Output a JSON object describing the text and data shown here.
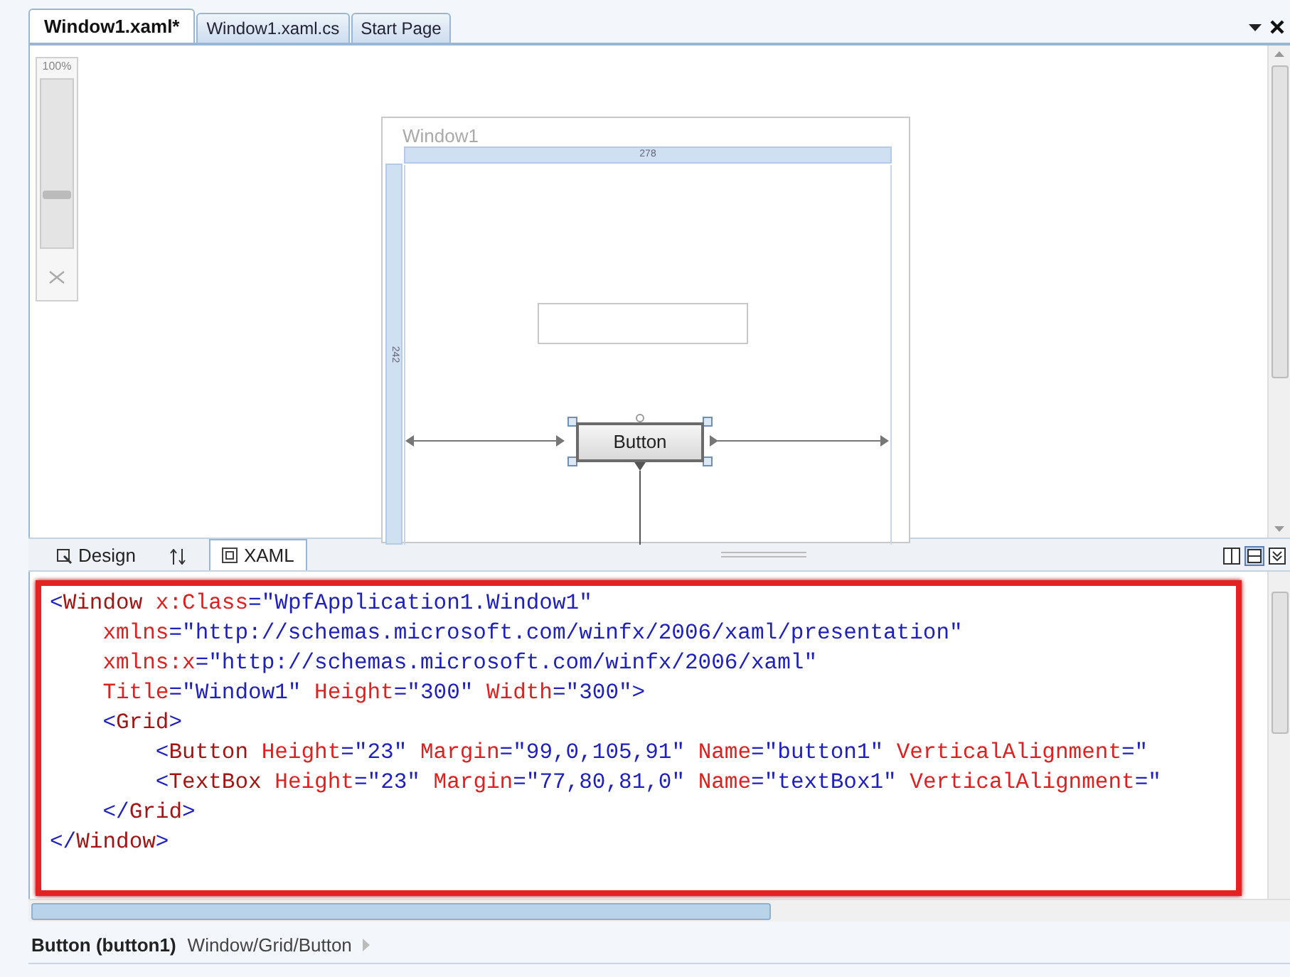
{
  "document_tabs": [
    {
      "label": "Window1.xaml*",
      "selected": true
    },
    {
      "label": "Window1.xaml.cs",
      "selected": false
    },
    {
      "label": "Start Page",
      "selected": false
    }
  ],
  "zoom": {
    "label": "100%",
    "level": 0.3
  },
  "designer": {
    "window_title": "Window1",
    "width_ruler": "278",
    "height_ruler": "242",
    "button_label": "Button"
  },
  "view_tabs": [
    {
      "kind": "design",
      "label": "Design",
      "selected": false
    },
    {
      "kind": "swap",
      "selected": false
    },
    {
      "kind": "xaml",
      "label": "XAML",
      "selected": true
    }
  ],
  "code_lines": [
    {
      "tokens": [
        {
          "kind": "punct",
          "text": "<"
        },
        {
          "kind": "element",
          "text": "Window"
        },
        {
          "kind": "attribute",
          "text": " x:Class"
        },
        {
          "kind": "punct",
          "text": "=\"WpfApplication1.Window1\""
        }
      ]
    },
    {
      "tokens": [
        {
          "kind": "attribute",
          "text": "    xmlns"
        },
        {
          "kind": "punct",
          "text": "=\"http://schemas.microsoft.com/winfx/2006/xaml/presentation\""
        }
      ]
    },
    {
      "tokens": [
        {
          "kind": "attribute",
          "text": "    xmlns:x"
        },
        {
          "kind": "punct",
          "text": "=\"http://schemas.microsoft.com/winfx/2006/xaml\""
        }
      ]
    },
    {
      "tokens": [
        {
          "kind": "attribute",
          "text": "    Title"
        },
        {
          "kind": "punct",
          "text": "=\"Window1\""
        },
        {
          "kind": "attribute",
          "text": " Height"
        },
        {
          "kind": "punct",
          "text": "=\"300\""
        },
        {
          "kind": "attribute",
          "text": " Width"
        },
        {
          "kind": "punct",
          "text": "=\"300\">"
        }
      ]
    },
    {
      "tokens": [
        {
          "kind": "punct",
          "text": "    <"
        },
        {
          "kind": "element",
          "text": "Grid"
        },
        {
          "kind": "punct",
          "text": ">"
        }
      ]
    },
    {
      "tokens": [
        {
          "kind": "punct",
          "text": "        <"
        },
        {
          "kind": "element",
          "text": "Button"
        },
        {
          "kind": "attribute",
          "text": " Height"
        },
        {
          "kind": "punct",
          "text": "=\"23\""
        },
        {
          "kind": "attribute",
          "text": " Margin"
        },
        {
          "kind": "punct",
          "text": "=\"99,0,105,91\""
        },
        {
          "kind": "attribute",
          "text": " Name"
        },
        {
          "kind": "punct",
          "text": "=\"button1\""
        },
        {
          "kind": "attribute",
          "text": " VerticalAlignment"
        },
        {
          "kind": "punct",
          "text": "=\""
        }
      ]
    },
    {
      "tokens": [
        {
          "kind": "punct",
          "text": "        <"
        },
        {
          "kind": "element",
          "text": "TextBox"
        },
        {
          "kind": "attribute",
          "text": " Height"
        },
        {
          "kind": "punct",
          "text": "=\"23\""
        },
        {
          "kind": "attribute",
          "text": " Margin"
        },
        {
          "kind": "punct",
          "text": "=\"77,80,81,0\""
        },
        {
          "kind": "attribute",
          "text": " Name"
        },
        {
          "kind": "punct",
          "text": "=\"textBox1\""
        },
        {
          "kind": "attribute",
          "text": " VerticalAlignment"
        },
        {
          "kind": "punct",
          "text": "=\""
        }
      ]
    },
    {
      "tokens": [
        {
          "kind": "punct",
          "text": "    </"
        },
        {
          "kind": "element",
          "text": "Grid"
        },
        {
          "kind": "punct",
          "text": ">"
        }
      ]
    },
    {
      "tokens": [
        {
          "kind": "punct",
          "text": "</"
        },
        {
          "kind": "element",
          "text": "Window"
        },
        {
          "kind": "punct",
          "text": ">"
        }
      ]
    }
  ],
  "status_bar": {
    "selection": "Button (button1)",
    "path": "Window/Grid/Button"
  }
}
